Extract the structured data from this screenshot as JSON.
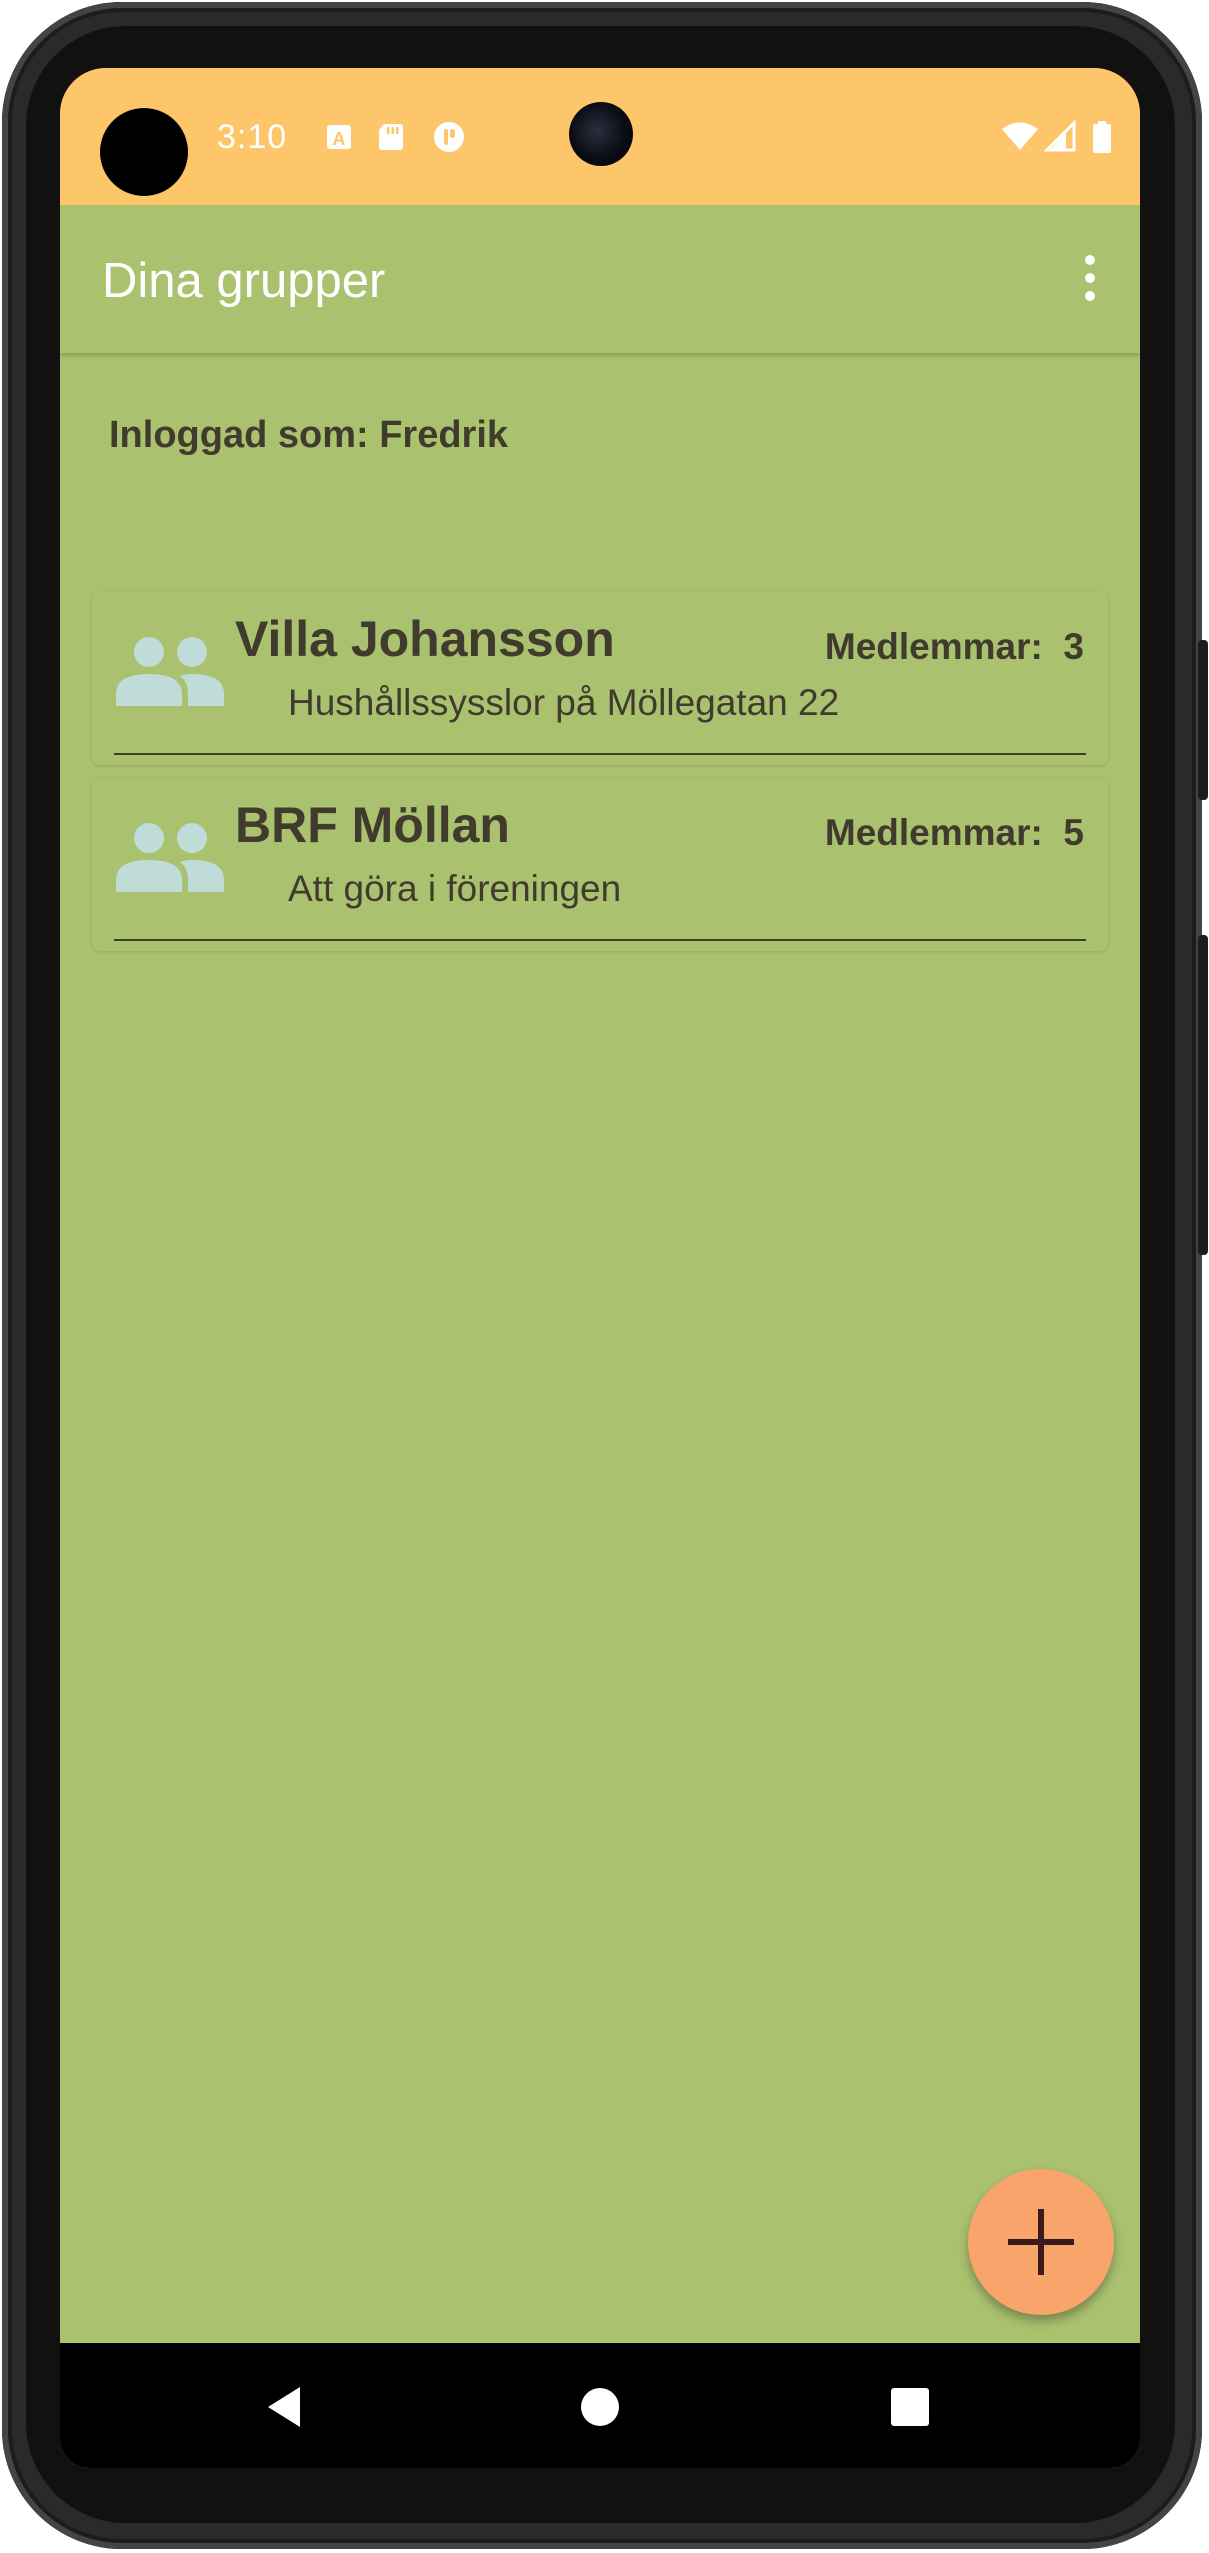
{
  "status_bar": {
    "time": "3:10",
    "background_color": "#fdc66b",
    "left_icons": [
      "a-square-icon",
      "sd-card-icon",
      "circle-app-icon"
    ],
    "right_icons": [
      "wifi-icon",
      "signal-icon",
      "battery-icon"
    ]
  },
  "app_bar": {
    "title": "Dina grupper",
    "menu_icon": "overflow-menu-icon"
  },
  "logged_in_text": "Inloggad som: Fredrik",
  "groups": [
    {
      "name": "Villa Johansson",
      "description": "Hushållssysslor på Möllegatan 22",
      "members_label": "Medlemmar:",
      "members_count": "3",
      "icon": "group-icon"
    },
    {
      "name": "BRF Möllan",
      "description": "Att göra i föreningen",
      "members_label": "Medlemmar:",
      "members_count": "5",
      "icon": "group-icon"
    }
  ],
  "fab": {
    "icon": "plus-icon",
    "color": "#f8a46a"
  },
  "nav_bar": {
    "buttons": [
      "back-icon",
      "home-icon",
      "recents-icon"
    ]
  },
  "colors": {
    "background": "#aac16f",
    "text": "#413b2e",
    "group_icon": "#c0dcd8"
  }
}
